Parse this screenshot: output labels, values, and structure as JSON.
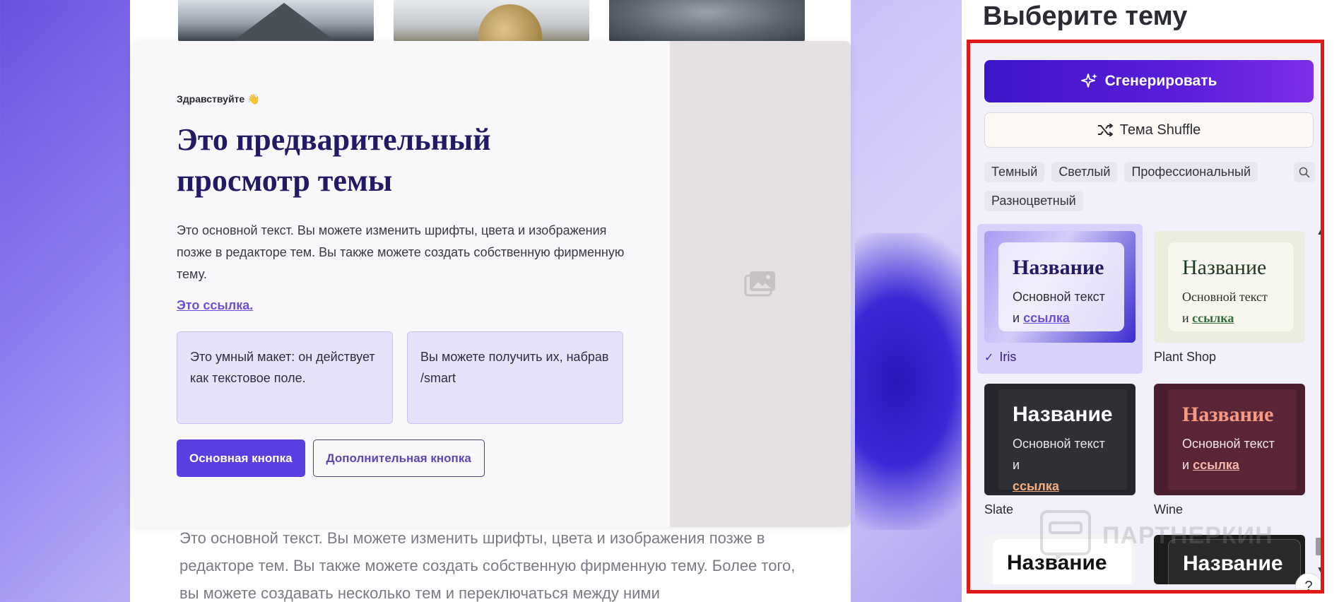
{
  "preview": {
    "greeting": "Здравствуйте 👋",
    "title": "Это предварительный просмотр темы",
    "body": "Это основной текст. Вы можете изменить шрифты, цвета и изображения позже в редакторе тем. Вы также можете создать собственную фирменную тему.",
    "link": "Это ссылка.",
    "smart_boxes": [
      "Это умный макет: он действует как текстовое поле.",
      "Вы можете получить их, набрав /smart"
    ],
    "primary_button": "Основная кнопка",
    "secondary_button": "Дополнительная кнопка"
  },
  "back_page": {
    "text": "Это основной текст. Вы можете изменить шрифты, цвета и изображения позже в редакторе тем. Вы также можете создать собственную фирменную тему. Более того, вы можете создавать несколько тем и переключаться между ними"
  },
  "panel": {
    "title": "Выберите тему",
    "generate_button": "Сгенерировать",
    "shuffle_button": "Тема Shuffle",
    "filters": [
      "Темный",
      "Светлый",
      "Профессиональный",
      "Разноцветный"
    ],
    "search_icon": "search-icon",
    "themes": [
      {
        "name": "Iris",
        "selected": true,
        "title": "Название",
        "text": "Основной текст",
        "and": "и",
        "link": "ссылка"
      },
      {
        "name": "Plant Shop",
        "selected": false,
        "title": "Название",
        "text": "Основной текст",
        "and": "и",
        "link": "ссылка"
      },
      {
        "name": "Slate",
        "selected": false,
        "title": "Название",
        "text": "Основной текст и",
        "and": "",
        "link": "ссылка"
      },
      {
        "name": "Wine",
        "selected": false,
        "title": "Название",
        "text": "Основной текст",
        "and": "и",
        "link": "ссылка"
      },
      {
        "name": "",
        "selected": false,
        "title": "Название",
        "text": "",
        "and": "",
        "link": ""
      },
      {
        "name": "",
        "selected": false,
        "title": "Название",
        "text": "",
        "and": "",
        "link": ""
      }
    ],
    "help": "?"
  },
  "watermark": "ПАРТНЕРКИН",
  "colors": {
    "accent": "#5a3fe0",
    "title_color": "#231a66",
    "frame_highlight": "#e01818",
    "generate_gradient_start": "#3d14c8",
    "generate_gradient_end": "#7b2ee6"
  }
}
